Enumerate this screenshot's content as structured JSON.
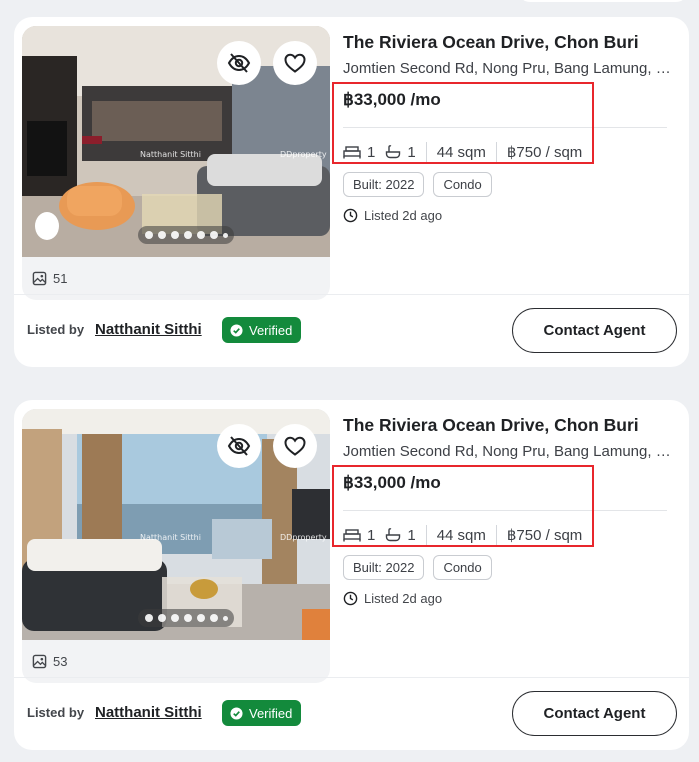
{
  "listings": [
    {
      "title": "The Riviera Ocean Drive, Chon Buri",
      "address": "Jomtien Second Rd, Nong Pru, Bang Lamung, Chon Buri",
      "price": "฿33,000 /mo",
      "beds": "1",
      "baths": "1",
      "area": "44 sqm",
      "price_per_sqm": "฿750 / sqm",
      "tags": [
        "Built: 2022",
        "Condo"
      ],
      "listed": "Listed 2d ago",
      "photo_count": "51",
      "watermark_name": "Natthanit Sitthi",
      "watermark_brand": "DDproperty",
      "listed_by_label": "Listed by",
      "agent_name": "Natthanit Sitthi",
      "verified_label": "Verified",
      "contact_label": "Contact Agent",
      "carousel_dots": 7,
      "carousel_active": 1
    },
    {
      "title": "The Riviera Ocean Drive, Chon Buri",
      "address": "Jomtien Second Rd, Nong Pru, Bang Lamung, Chon Buri",
      "price": "฿33,000 /mo",
      "beds": "1",
      "baths": "1",
      "area": "44 sqm",
      "price_per_sqm": "฿750 / sqm",
      "tags": [
        "Built: 2022",
        "Condo"
      ],
      "listed": "Listed 2d ago",
      "photo_count": "53",
      "watermark_name": "Natthanit Sitthi",
      "watermark_brand": "DDproperty",
      "listed_by_label": "Listed by",
      "agent_name": "Natthanit Sitthi",
      "verified_label": "Verified",
      "contact_label": "Contact Agent",
      "carousel_dots": 7,
      "carousel_active": 1
    }
  ],
  "icons": {
    "hide": "eye-off-icon",
    "favorite": "heart-icon",
    "bed": "bed-icon",
    "bath": "bathtub-icon",
    "clock": "clock-icon",
    "gallery": "gallery-icon",
    "verified": "verified-badge-icon"
  },
  "colors": {
    "verified_bg": "#138a3c",
    "highlight_border": "#e8262c"
  }
}
